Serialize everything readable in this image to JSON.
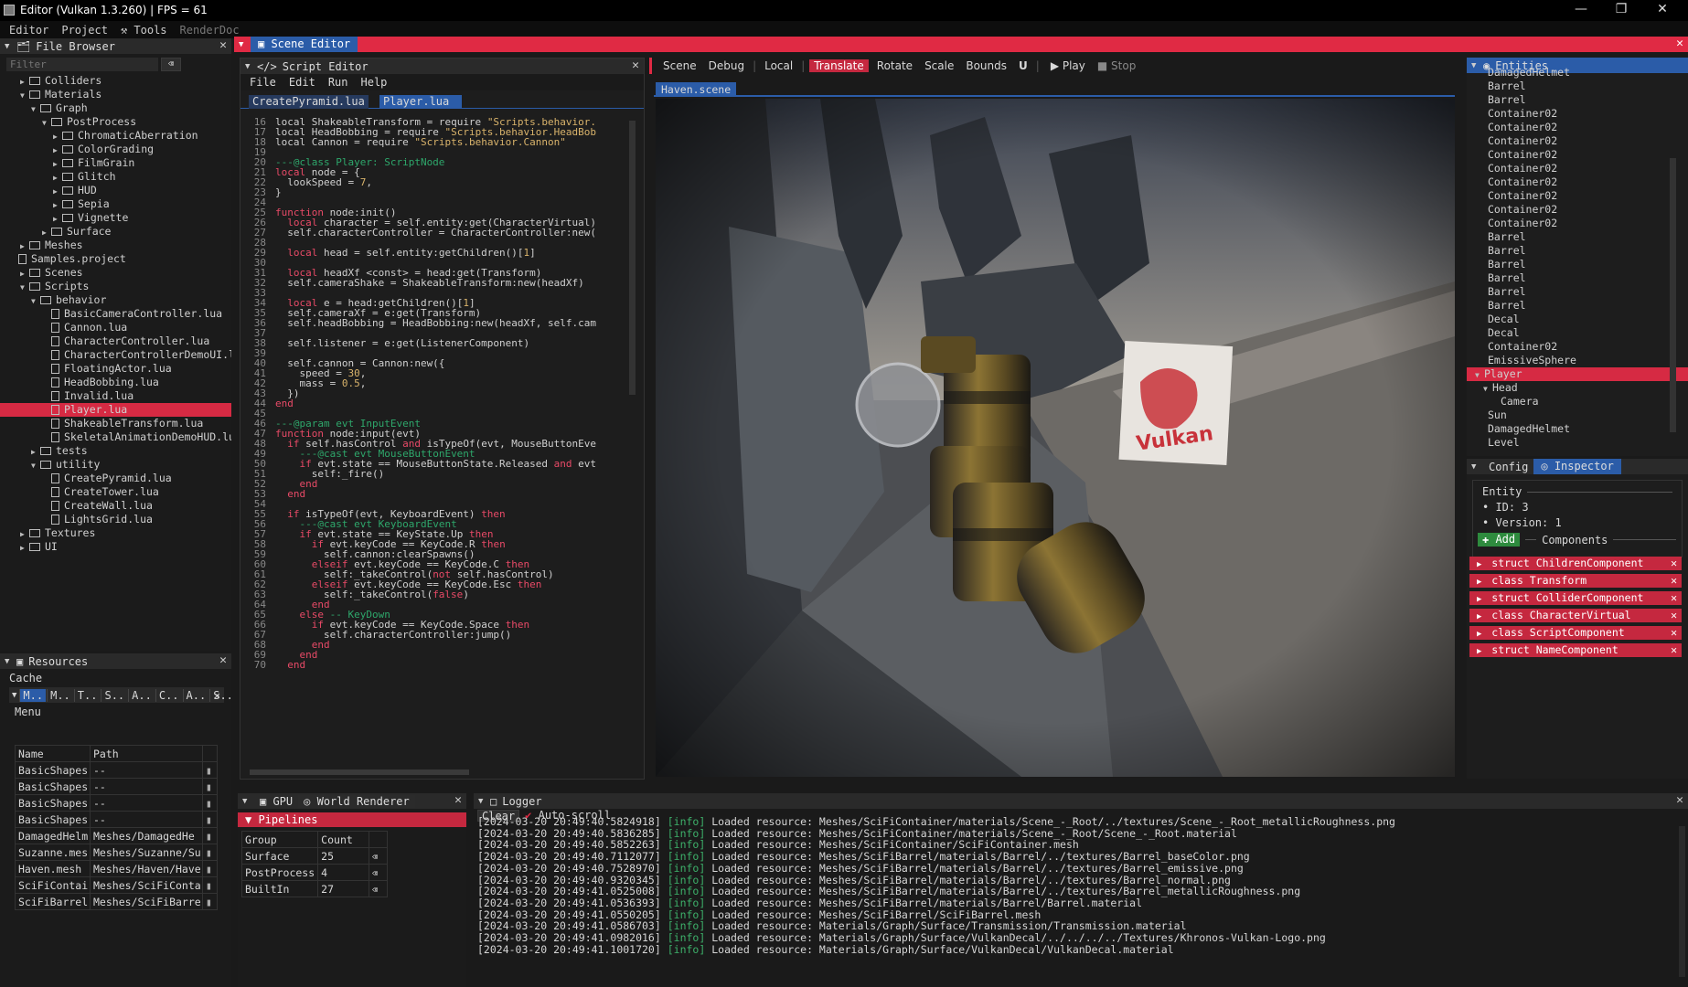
{
  "window": {
    "title": "Editor (Vulkan 1.3.260) | FPS = 61",
    "min": "—",
    "max": "❐",
    "close": "✕"
  },
  "menubar": [
    "Editor",
    "Project",
    "Tools",
    "RenderDoc"
  ],
  "file_browser": {
    "title": "File Browser",
    "filter_placeholder": "Filter",
    "rows": [
      {
        "d": 1,
        "a": "▶",
        "t": "Colliders",
        "k": "f"
      },
      {
        "d": 1,
        "a": "▼",
        "t": "Materials",
        "k": "f"
      },
      {
        "d": 2,
        "a": "▼",
        "t": "Graph",
        "k": "f"
      },
      {
        "d": 3,
        "a": "▼",
        "t": "PostProcess",
        "k": "f"
      },
      {
        "d": 4,
        "a": "▶",
        "t": "ChromaticAberration",
        "k": "f"
      },
      {
        "d": 4,
        "a": "▶",
        "t": "ColorGrading",
        "k": "f"
      },
      {
        "d": 4,
        "a": "▶",
        "t": "FilmGrain",
        "k": "f"
      },
      {
        "d": 4,
        "a": "▶",
        "t": "Glitch",
        "k": "f"
      },
      {
        "d": 4,
        "a": "▶",
        "t": "HUD",
        "k": "f"
      },
      {
        "d": 4,
        "a": "▶",
        "t": "Sepia",
        "k": "f"
      },
      {
        "d": 4,
        "a": "▶",
        "t": "Vignette",
        "k": "f"
      },
      {
        "d": 3,
        "a": "▶",
        "t": "Surface",
        "k": "f"
      },
      {
        "d": 1,
        "a": "▶",
        "t": "Meshes",
        "k": "f"
      },
      {
        "d": 0,
        "a": "",
        "t": "Samples.project",
        "k": "p"
      },
      {
        "d": 1,
        "a": "▶",
        "t": "Scenes",
        "k": "f"
      },
      {
        "d": 1,
        "a": "▼",
        "t": "Scripts",
        "k": "f"
      },
      {
        "d": 2,
        "a": "▼",
        "t": "behavior",
        "k": "f"
      },
      {
        "d": 3,
        "a": "",
        "t": "BasicCameraController.lua",
        "k": "p"
      },
      {
        "d": 3,
        "a": "",
        "t": "Cannon.lua",
        "k": "p"
      },
      {
        "d": 3,
        "a": "",
        "t": "CharacterController.lua",
        "k": "p"
      },
      {
        "d": 3,
        "a": "",
        "t": "CharacterControllerDemoUI.lu",
        "k": "p"
      },
      {
        "d": 3,
        "a": "",
        "t": "FloatingActor.lua",
        "k": "p"
      },
      {
        "d": 3,
        "a": "",
        "t": "HeadBobbing.lua",
        "k": "p"
      },
      {
        "d": 3,
        "a": "",
        "t": "Invalid.lua",
        "k": "p"
      },
      {
        "d": 3,
        "a": "",
        "t": "Player.lua",
        "k": "p",
        "sel": true
      },
      {
        "d": 3,
        "a": "",
        "t": "ShakeableTransform.lua",
        "k": "p"
      },
      {
        "d": 3,
        "a": "",
        "t": "SkeletalAnimationDemoHUD.lua",
        "k": "p"
      },
      {
        "d": 2,
        "a": "▶",
        "t": "tests",
        "k": "f"
      },
      {
        "d": 2,
        "a": "▼",
        "t": "utility",
        "k": "f"
      },
      {
        "d": 3,
        "a": "",
        "t": "CreatePyramid.lua",
        "k": "p"
      },
      {
        "d": 3,
        "a": "",
        "t": "CreateTower.lua",
        "k": "p"
      },
      {
        "d": 3,
        "a": "",
        "t": "CreateWall.lua",
        "k": "p"
      },
      {
        "d": 3,
        "a": "",
        "t": "LightsGrid.lua",
        "k": "p"
      },
      {
        "d": 1,
        "a": "▶",
        "t": "Textures",
        "k": "f"
      },
      {
        "d": 1,
        "a": "▶",
        "t": "UI",
        "k": "f"
      }
    ]
  },
  "resources": {
    "title": "Resources",
    "cache": "Cache",
    "menu": "Menu",
    "tabs": [
      "M..",
      "M..",
      "T..",
      "S..",
      "A..",
      "C..",
      "A..",
      "S.."
    ],
    "cols": [
      "Name",
      "Path"
    ],
    "rows": [
      [
        "BasicShapes",
        "--"
      ],
      [
        "BasicShapes",
        "--"
      ],
      [
        "BasicShapes",
        "--"
      ],
      [
        "BasicShapes",
        "--"
      ],
      [
        "DamagedHelm",
        "Meshes/DamagedHe"
      ],
      [
        "Suzanne.mes",
        "Meshes/Suzanne/Su"
      ],
      [
        "Haven.mesh",
        "Meshes/Haven/Have"
      ],
      [
        "SciFiContai",
        "Meshes/SciFiConta"
      ],
      [
        "SciFiBarrel",
        "Meshes/SciFiBarre"
      ]
    ]
  },
  "scene_editor": {
    "title": "Scene Editor"
  },
  "script_editor": {
    "title": "Script Editor",
    "menu": [
      "File",
      "Edit",
      "Run",
      "Help"
    ],
    "tabs": [
      "CreatePyramid.lua",
      "Player.lua"
    ]
  },
  "scene_toolbar": {
    "items": [
      "Scene",
      "Debug",
      "Local",
      "Translate",
      "Rotate",
      "Scale",
      "Bounds"
    ],
    "magnet": "U",
    "play": "Play",
    "stop": "Stop",
    "tab": "Haven.scene"
  },
  "entities": {
    "title": "Entities",
    "rows": [
      [
        "DamagedHelmet",
        0
      ],
      [
        "Barrel",
        0
      ],
      [
        "Barrel",
        0
      ],
      [
        "Container02",
        0
      ],
      [
        "Container02",
        0
      ],
      [
        "Container02",
        0
      ],
      [
        "Container02",
        0
      ],
      [
        "Container02",
        0
      ],
      [
        "Container02",
        0
      ],
      [
        "Container02",
        0
      ],
      [
        "Container02",
        0
      ],
      [
        "Container02",
        0
      ],
      [
        "Barrel",
        0
      ],
      [
        "Barrel",
        0
      ],
      [
        "Barrel",
        0
      ],
      [
        "Barrel",
        0
      ],
      [
        "Barrel",
        0
      ],
      [
        "Barrel",
        0
      ],
      [
        "Decal",
        0
      ],
      [
        "Decal",
        0
      ],
      [
        "Container02",
        0
      ],
      [
        "EmissiveSphere",
        0
      ],
      [
        "Player",
        0
      ],
      [
        "Head",
        1
      ],
      [
        "Camera",
        2
      ],
      [
        "Sun",
        0
      ],
      [
        "DamagedHelmet",
        0
      ],
      [
        "Level",
        0
      ]
    ]
  },
  "inspector": {
    "tab_config": "Config",
    "tab_inspector": "Inspector",
    "entity_label": "Entity",
    "id": "ID: 3",
    "version": "Version: 1",
    "add": "Add",
    "components_label": "Components",
    "components": [
      "struct ChildrenComponent",
      "class Transform",
      "struct ColliderComponent",
      "class CharacterVirtual",
      "class ScriptComponent",
      "struct NameComponent"
    ]
  },
  "gpu": {
    "tab1": "GPU",
    "tab2": "World Renderer",
    "pipelines": "Pipelines",
    "cols": [
      "Group",
      "Count"
    ],
    "rows": [
      [
        "Surface",
        "25"
      ],
      [
        "PostProcess",
        "4"
      ],
      [
        "BuiltIn",
        "27"
      ]
    ]
  },
  "logger": {
    "title": "Logger",
    "clear": "Clear",
    "autoscroll": "Auto-scroll",
    "lines": [
      [
        "[2024-03-20 20:49:40.5824918]",
        "[info]",
        "Loaded resource: Meshes/SciFiContainer/materials/Scene_-_Root/../textures/Scene_-_Root_metallicRoughness.png"
      ],
      [
        "[2024-03-20 20:49:40.5836285]",
        "[info]",
        "Loaded resource: Meshes/SciFiContainer/materials/Scene_-_Root/Scene_-_Root.material"
      ],
      [
        "[2024-03-20 20:49:40.5852263]",
        "[info]",
        "Loaded resource: Meshes/SciFiContainer/SciFiContainer.mesh"
      ],
      [
        "[2024-03-20 20:49:40.7112077]",
        "[info]",
        "Loaded resource: Meshes/SciFiBarrel/materials/Barrel/../textures/Barrel_baseColor.png"
      ],
      [
        "[2024-03-20 20:49:40.7528970]",
        "[info]",
        "Loaded resource: Meshes/SciFiBarrel/materials/Barrel/../textures/Barrel_emissive.png"
      ],
      [
        "[2024-03-20 20:49:40.9320345]",
        "[info]",
        "Loaded resource: Meshes/SciFiBarrel/materials/Barrel/../textures/Barrel_normal.png"
      ],
      [
        "[2024-03-20 20:49:41.0525008]",
        "[info]",
        "Loaded resource: Meshes/SciFiBarrel/materials/Barrel/../textures/Barrel_metallicRoughness.png"
      ],
      [
        "[2024-03-20 20:49:41.0536393]",
        "[info]",
        "Loaded resource: Meshes/SciFiBarrel/materials/Barrel/Barrel.material"
      ],
      [
        "[2024-03-20 20:49:41.0550205]",
        "[info]",
        "Loaded resource: Meshes/SciFiBarrel/SciFiBarrel.mesh"
      ],
      [
        "[2024-03-20 20:49:41.0586703]",
        "[info]",
        "Loaded resource: Materials/Graph/Surface/Transmission/Transmission.material"
      ],
      [
        "[2024-03-20 20:49:41.0982016]",
        "[info]",
        "Loaded resource: Materials/Graph/Surface/VulkanDecal/../../../../Textures/Khronos-Vulkan-Logo.png"
      ],
      [
        "[2024-03-20 20:49:41.1001720]",
        "[info]",
        "Loaded resource: Materials/Graph/Surface/VulkanDecal/VulkanDecal.material"
      ]
    ]
  },
  "code": [
    [
      16,
      [
        [
          "",
          "local "
        ],
        [
          "",
          "ShakeableTransform = require "
        ],
        [
          "s",
          "\"Scripts.behavior."
        ]
      ]
    ],
    [
      17,
      [
        [
          "",
          "local "
        ],
        [
          "",
          "HeadBobbing = require "
        ],
        [
          "s",
          "\"Scripts.behavior.HeadBob"
        ]
      ]
    ],
    [
      18,
      [
        [
          "",
          "local "
        ],
        [
          "",
          "Cannon = require "
        ],
        [
          "s",
          "\"Scripts.behavior.Cannon\""
        ]
      ]
    ],
    [
      19,
      []
    ],
    [
      20,
      [
        [
          "c",
          "---@class Player: ScriptNode"
        ]
      ]
    ],
    [
      21,
      [
        [
          "k",
          "local "
        ],
        [
          "",
          "node = {"
        ]
      ]
    ],
    [
      22,
      [
        [
          "",
          "  lookSpeed = "
        ],
        [
          "n",
          "7"
        ],
        [
          "",
          ","
        ]
      ]
    ],
    [
      23,
      [
        [
          "",
          "}"
        ]
      ]
    ],
    [
      24,
      []
    ],
    [
      25,
      [
        [
          "k",
          "function "
        ],
        [
          "",
          "node:init()"
        ]
      ]
    ],
    [
      26,
      [
        [
          "",
          "  "
        ],
        [
          "k",
          "local "
        ],
        [
          "",
          "character = self.entity:get(CharacterVirtual)"
        ]
      ]
    ],
    [
      27,
      [
        [
          "",
          "  self.characterController = CharacterController:new("
        ]
      ]
    ],
    [
      28,
      []
    ],
    [
      29,
      [
        [
          "",
          "  "
        ],
        [
          "k",
          "local "
        ],
        [
          "",
          "head = self.entity:getChildren()["
        ],
        [
          "n",
          "1"
        ],
        [
          "",
          "]"
        ]
      ]
    ],
    [
      30,
      []
    ],
    [
      31,
      [
        [
          "",
          "  "
        ],
        [
          "k",
          "local "
        ],
        [
          "",
          "headXf <const> = head:get(Transform)"
        ]
      ]
    ],
    [
      32,
      [
        [
          "",
          "  self.cameraShake = ShakeableTransform:new(headXf)"
        ]
      ]
    ],
    [
      33,
      []
    ],
    [
      34,
      [
        [
          "",
          "  "
        ],
        [
          "k",
          "local "
        ],
        [
          "",
          "e = head:getChildren()["
        ],
        [
          "n",
          "1"
        ],
        [
          "",
          "]"
        ]
      ]
    ],
    [
      35,
      [
        [
          "",
          "  self.cameraXf = e:get(Transform)"
        ]
      ]
    ],
    [
      36,
      [
        [
          "",
          "  self.headBobbing = HeadBobbing:new(headXf, self.cam"
        ]
      ]
    ],
    [
      37,
      []
    ],
    [
      38,
      [
        [
          "",
          "  self.listener = e:get(ListenerComponent)"
        ]
      ]
    ],
    [
      39,
      []
    ],
    [
      40,
      [
        [
          "",
          "  self.cannon = Cannon:new({"
        ]
      ]
    ],
    [
      41,
      [
        [
          "",
          "    speed = "
        ],
        [
          "n",
          "30"
        ],
        [
          "",
          ","
        ]
      ]
    ],
    [
      42,
      [
        [
          "",
          "    mass = "
        ],
        [
          "n",
          "0.5"
        ],
        [
          "",
          ","
        ]
      ]
    ],
    [
      43,
      [
        [
          "",
          "  })"
        ]
      ]
    ],
    [
      44,
      [
        [
          "k",
          "end"
        ]
      ]
    ],
    [
      45,
      []
    ],
    [
      46,
      [
        [
          "c",
          "---@param evt InputEvent"
        ]
      ]
    ],
    [
      47,
      [
        [
          "k",
          "function "
        ],
        [
          "",
          "node:input(evt)"
        ]
      ]
    ],
    [
      48,
      [
        [
          "",
          "  "
        ],
        [
          "k",
          "if "
        ],
        [
          "",
          "self.hasControl "
        ],
        [
          "k",
          "and "
        ],
        [
          "",
          "isTypeOf(evt, MouseButtonEve"
        ]
      ]
    ],
    [
      49,
      [
        [
          "",
          "    "
        ],
        [
          "c",
          "---@cast evt MouseButtonEvent"
        ]
      ]
    ],
    [
      50,
      [
        [
          "",
          "    "
        ],
        [
          "k",
          "if "
        ],
        [
          "",
          "evt.state == MouseButtonState.Released "
        ],
        [
          "k",
          "and "
        ],
        [
          "",
          "evt"
        ]
      ]
    ],
    [
      51,
      [
        [
          "",
          "      self:_fire()"
        ]
      ]
    ],
    [
      52,
      [
        [
          "",
          "    "
        ],
        [
          "k",
          "end"
        ]
      ]
    ],
    [
      53,
      [
        [
          "",
          "  "
        ],
        [
          "k",
          "end"
        ]
      ]
    ],
    [
      54,
      []
    ],
    [
      55,
      [
        [
          "",
          "  "
        ],
        [
          "k",
          "if "
        ],
        [
          "",
          "isTypeOf(evt, KeyboardEvent) "
        ],
        [
          "k",
          "then"
        ]
      ]
    ],
    [
      56,
      [
        [
          "",
          "    "
        ],
        [
          "c",
          "---@cast evt KeyboardEvent"
        ]
      ]
    ],
    [
      57,
      [
        [
          "",
          "    "
        ],
        [
          "k",
          "if "
        ],
        [
          "",
          "evt.state == KeyState.Up "
        ],
        [
          "k",
          "then"
        ]
      ]
    ],
    [
      58,
      [
        [
          "",
          "      "
        ],
        [
          "k",
          "if "
        ],
        [
          "",
          "evt.keyCode == KeyCode.R "
        ],
        [
          "k",
          "then"
        ]
      ]
    ],
    [
      59,
      [
        [
          "",
          "        self.cannon:clearSpawns()"
        ]
      ]
    ],
    [
      60,
      [
        [
          "",
          "      "
        ],
        [
          "k",
          "elseif "
        ],
        [
          "",
          "evt.keyCode == KeyCode.C "
        ],
        [
          "k",
          "then"
        ]
      ]
    ],
    [
      61,
      [
        [
          "",
          "        self:_takeControl("
        ],
        [
          "k",
          "not "
        ],
        [
          "",
          "self.hasControl)"
        ]
      ]
    ],
    [
      62,
      [
        [
          "",
          "      "
        ],
        [
          "k",
          "elseif "
        ],
        [
          "",
          "evt.keyCode == KeyCode.Esc "
        ],
        [
          "k",
          "then"
        ]
      ]
    ],
    [
      63,
      [
        [
          "",
          "        self:_takeControl("
        ],
        [
          "k",
          "false"
        ],
        [
          "",
          ")"
        ]
      ]
    ],
    [
      64,
      [
        [
          "",
          "      "
        ],
        [
          "k",
          "end"
        ]
      ]
    ],
    [
      65,
      [
        [
          "",
          "    "
        ],
        [
          "k",
          "else "
        ],
        [
          "c",
          "-- KeyDown"
        ]
      ]
    ],
    [
      66,
      [
        [
          "",
          "      "
        ],
        [
          "k",
          "if "
        ],
        [
          "",
          "evt.keyCode == KeyCode.Space "
        ],
        [
          "k",
          "then"
        ]
      ]
    ],
    [
      67,
      [
        [
          "",
          "        self.characterController:jump()"
        ]
      ]
    ],
    [
      68,
      [
        [
          "",
          "      "
        ],
        [
          "k",
          "end"
        ]
      ]
    ],
    [
      69,
      [
        [
          "",
          "    "
        ],
        [
          "k",
          "end"
        ]
      ]
    ],
    [
      70,
      [
        [
          "",
          "  "
        ],
        [
          "k",
          "end"
        ]
      ]
    ]
  ]
}
